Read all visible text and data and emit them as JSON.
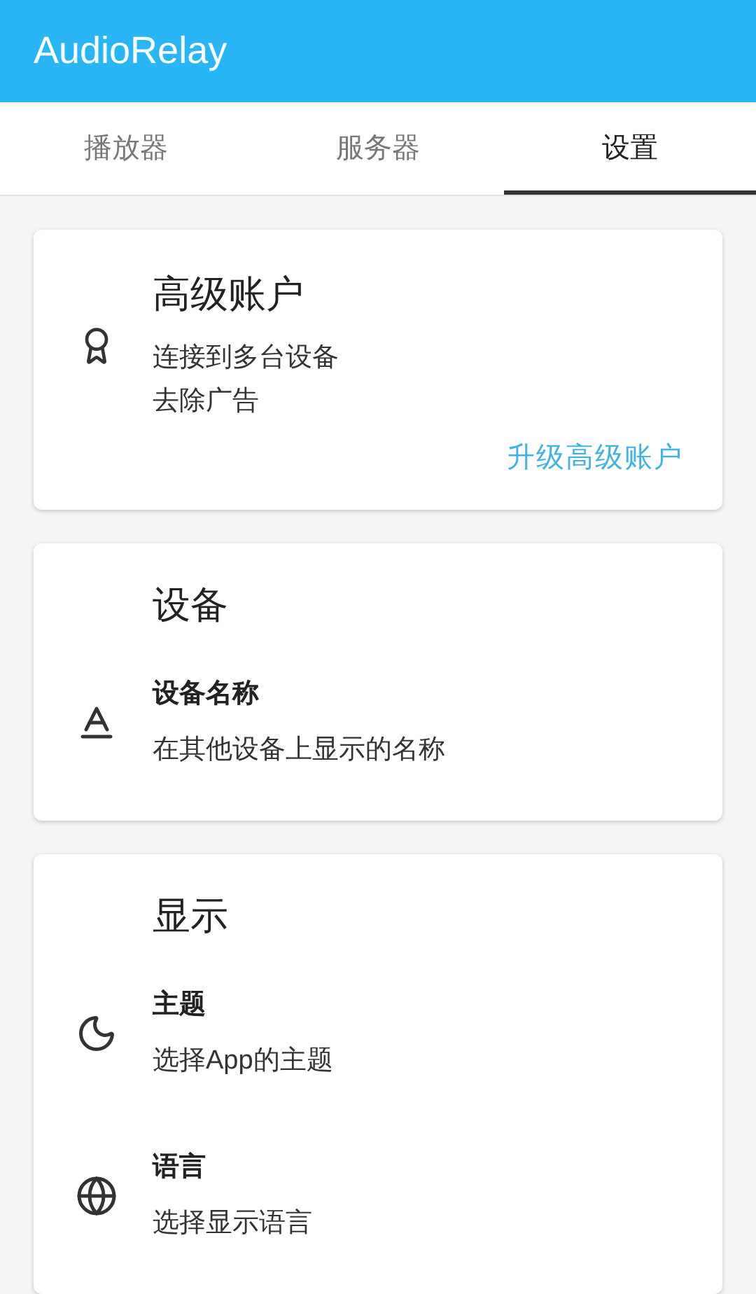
{
  "app_bar": {
    "title": "AudioRelay"
  },
  "tabs": [
    {
      "label": "播放器",
      "selected": false
    },
    {
      "label": "服务器",
      "selected": false
    },
    {
      "label": "设置",
      "selected": true
    }
  ],
  "cards": [
    {
      "kind": "premium",
      "title": "高级账户",
      "lines": [
        "连接到多台设备",
        "去除广告"
      ],
      "action": "升级高级账户"
    },
    {
      "kind": "settings",
      "title": "设备",
      "items": [
        {
          "label": "设备名称",
          "description": "在其他设备上显示的名称"
        }
      ]
    },
    {
      "kind": "settings",
      "title": "显示",
      "items": [
        {
          "label": "主题",
          "description": "选择App的主题"
        },
        {
          "label": "语言",
          "description": "选择显示语言"
        }
      ]
    }
  ]
}
